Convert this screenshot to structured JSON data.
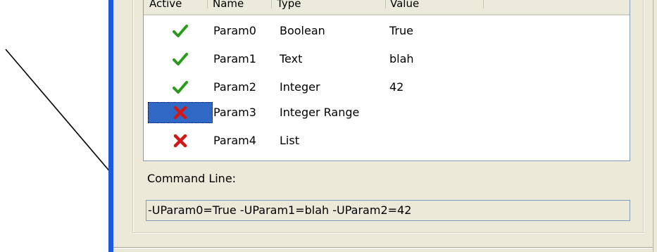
{
  "list": {
    "columns": [
      "Active",
      "Name",
      "Type",
      "Value"
    ],
    "rows": [
      {
        "active": true,
        "name": "Param0",
        "type": "Boolean",
        "value": "True"
      },
      {
        "active": true,
        "name": "Param1",
        "type": "Text",
        "value": "blah"
      },
      {
        "active": true,
        "name": "Param2",
        "type": "Integer",
        "value": "42"
      },
      {
        "active": false,
        "name": "Param3",
        "type": "Integer Range",
        "value": "",
        "selected": true
      },
      {
        "active": false,
        "name": "Param4",
        "type": "List",
        "value": ""
      }
    ]
  },
  "command_line": {
    "label": "Command Line:",
    "value": "-UParam0=True -UParam1=blah -UParam2=42"
  },
  "icons": {
    "active_true": "check-icon",
    "active_false": "cross-icon"
  },
  "colors": {
    "window_border": "#1f57e0",
    "panel_bg": "#ece9d8",
    "selection": "#3169c6",
    "check": "#2a9a1c",
    "cross": "#d01818",
    "arrow": "#000000"
  }
}
